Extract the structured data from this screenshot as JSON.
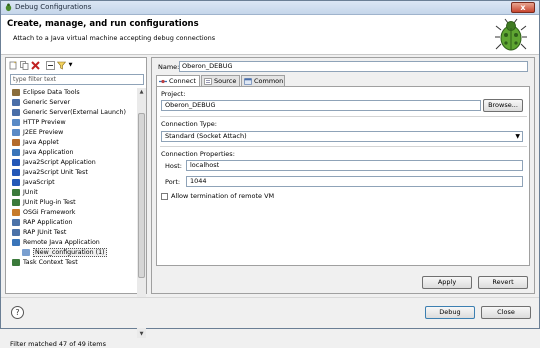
{
  "window": {
    "title": "Debug Configurations",
    "close_glyph": "x"
  },
  "header": {
    "title": "Create, manage, and run configurations",
    "subtitle": "Attach to a Java virtual machine accepting debug connections"
  },
  "left": {
    "toolbar_icons": [
      "new-config-icon",
      "duplicate-icon",
      "delete-icon",
      "collapse-all-icon",
      "filter-icon",
      "dropdown-arrow-icon"
    ],
    "filter_placeholder": "type filter text",
    "tree_items": [
      {
        "label": "Eclipse Data Tools",
        "icon": "data-tools-icon",
        "color": "#8a6d3b",
        "indent": 0
      },
      {
        "label": "Generic Server",
        "icon": "server-icon",
        "color": "#4a6ea8",
        "indent": 0
      },
      {
        "label": "Generic Server(External Launch)",
        "icon": "server-icon",
        "color": "#4a6ea8",
        "indent": 0
      },
      {
        "label": "HTTP Preview",
        "icon": "http-icon",
        "color": "#5a8ac6",
        "indent": 0
      },
      {
        "label": "J2EE Preview",
        "icon": "j2ee-icon",
        "color": "#5a8ac6",
        "indent": 0
      },
      {
        "label": "Java Applet",
        "icon": "applet-icon",
        "color": "#b46b2b",
        "indent": 0
      },
      {
        "label": "Java Application",
        "icon": "java-app-icon",
        "color": "#3a75b9",
        "indent": 0
      },
      {
        "label": "Java2Script Application",
        "icon": "j2s-icon",
        "color": "#2458b8",
        "indent": 0
      },
      {
        "label": "Java2Script Unit Test",
        "icon": "j2s-test-icon",
        "color": "#2458b8",
        "indent": 0
      },
      {
        "label": "JavaScript",
        "icon": "javascript-icon",
        "color": "#2458b8",
        "indent": 0
      },
      {
        "label": "JUnit",
        "icon": "junit-icon",
        "color": "#3b7a3b",
        "indent": 0
      },
      {
        "label": "JUnit Plug-in Test",
        "icon": "junit-plugin-icon",
        "color": "#3b7a3b",
        "indent": 0
      },
      {
        "label": "OSGi Framework",
        "icon": "osgi-icon",
        "color": "#c77b2a",
        "indent": 0
      },
      {
        "label": "RAP Application",
        "icon": "rap-icon",
        "color": "#4b72a8",
        "indent": 0
      },
      {
        "label": "RAP JUnit Test",
        "icon": "rap-test-icon",
        "color": "#4b72a8",
        "indent": 0
      },
      {
        "label": "Remote Java Application",
        "icon": "remote-java-icon",
        "color": "#3a75b9",
        "indent": 0
      },
      {
        "label": "New_configuration (1)",
        "icon": "config-icon",
        "color": "#7a9fd0",
        "indent": 1,
        "selected": true
      },
      {
        "label": "Task Context Test",
        "icon": "task-test-icon",
        "color": "#3b7a3b",
        "indent": 0
      }
    ],
    "status": "Filter matched 47 of 49 items"
  },
  "right": {
    "name_label": "Name:",
    "name_value": "Oberon_DEBUG",
    "tabs": [
      {
        "label": "Connect",
        "icon": "connect-icon",
        "active": true
      },
      {
        "label": "Source",
        "icon": "source-icon",
        "active": false
      },
      {
        "label": "Common",
        "icon": "common-icon",
        "active": false
      }
    ],
    "project_label": "Project:",
    "project_value": "Oberon_DEBUG",
    "browse_label": "Browse...",
    "conn_type_label": "Connection Type:",
    "conn_type_value": "Standard (Socket Attach)",
    "conn_props_label": "Connection Properties:",
    "host_label": "Host:",
    "host_value": "localhost",
    "port_label": "Port:",
    "port_value": "1044",
    "allow_term_label": "Allow termination of remote VM",
    "apply_label": "Apply",
    "revert_label": "Revert"
  },
  "bottom": {
    "help_glyph": "?",
    "debug_label": "Debug",
    "close_label": "Close"
  }
}
